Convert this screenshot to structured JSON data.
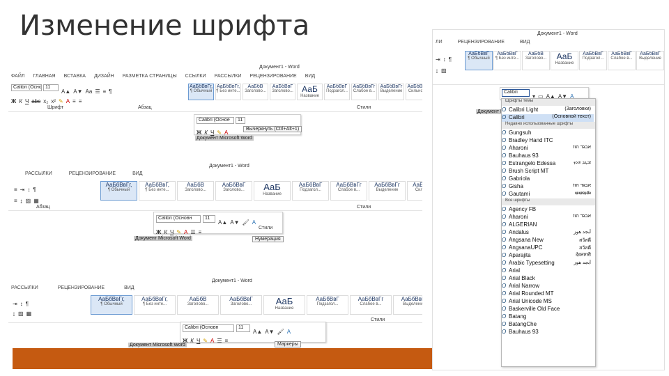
{
  "title": "Изменение шрифта",
  "accent_color": "#c55a11",
  "shot1": {
    "window_title": "Документ1 - Word",
    "tabs": [
      "ФАЙЛ",
      "ГЛАВНАЯ",
      "ВСТАВКА",
      "ДИЗАЙН",
      "РАЗМЕТКА СТРАНИЦЫ",
      "ССЫЛКИ",
      "РАССЫЛКИ",
      "РЕЦЕНЗИРОВАНИЕ",
      "ВИД"
    ],
    "font_name": "Calibri (Осно",
    "font_size": "11",
    "styles": [
      {
        "sample": "АаБбВвГг,",
        "name": "¶ Обычный"
      },
      {
        "sample": "АаБбВвГг,",
        "name": "¶ Без инте..."
      },
      {
        "sample": "АаБбВ",
        "name": "Заголово..."
      },
      {
        "sample": "АаБбВвГ",
        "name": "Заголово..."
      },
      {
        "sample": "АаБ",
        "name": "Название"
      },
      {
        "sample": "АаБбВвГ",
        "name": "Подзагол..."
      },
      {
        "sample": "АаБбВвГг",
        "name": "Слабое в..."
      },
      {
        "sample": "АаБбВвГг",
        "name": "Выделение"
      },
      {
        "sample": "АаБбВвГг",
        "name": "Сильное..."
      }
    ],
    "group_labels": [
      "Шрифт",
      "Абзац",
      "Стили"
    ],
    "mini_font": "Calibri (Осное",
    "mini_size": "11",
    "tooltip": "Вычеркнуть (Ctrl+Alt+1)",
    "doc_text": "Документ Microsoft Word"
  },
  "shot2": {
    "window_title": "Документ1 - Word",
    "tabs": [
      "РАССЫЛКИ",
      "РЕЦЕНЗИРОВАНИЕ",
      "ВИД"
    ],
    "styles": [
      {
        "sample": "АаБбВвГг,",
        "name": "¶ Обычный"
      },
      {
        "sample": "АаБбВвГ,",
        "name": "¶ Без инте..."
      },
      {
        "sample": "АаБбВ",
        "name": "Заголово..."
      },
      {
        "sample": "АаБбВвГ",
        "name": "Заголово..."
      },
      {
        "sample": "АаБ",
        "name": "Название"
      },
      {
        "sample": "АаБбВвГ",
        "name": "Подзагол..."
      },
      {
        "sample": "АаБбВвГг",
        "name": "Слабое в..."
      },
      {
        "sample": "АаБбВвГг",
        "name": "Выделение"
      },
      {
        "sample": "АаБбВвГг",
        "name": "Сильное..."
      }
    ],
    "group_labels": [
      "Абзац",
      "Стили"
    ],
    "mini_font": "Calibri (Основн",
    "mini_size": "11",
    "mini_styles_label": "Стили",
    "tooltip": "Нумерация",
    "doc_text": "Документ Microsoft Word"
  },
  "shot3": {
    "window_title": "Документ1 - Word",
    "tabs": [
      "РАССЫЛКИ",
      "РЕЦЕНЗИРОВАНИЕ",
      "ВИД"
    ],
    "styles": [
      {
        "sample": "АаБбВвГг,",
        "name": "¶ Обычный"
      },
      {
        "sample": "АаБбВвГг,",
        "name": "¶ Без инте..."
      },
      {
        "sample": "АаБбВ",
        "name": "Заголово..."
      },
      {
        "sample": "АаБбВвГ",
        "name": "Заголово..."
      },
      {
        "sample": "АаБ",
        "name": "Название"
      },
      {
        "sample": "АаБбВвГ",
        "name": "Подзагол..."
      },
      {
        "sample": "АаБбВвГг",
        "name": "Слабое в..."
      },
      {
        "sample": "АаБбВвГг",
        "name": "Выделение"
      }
    ],
    "group_labels": [
      "Стили"
    ],
    "mini_font": "Calibri (Основн",
    "mini_size": "11",
    "tooltip": "Маркеры",
    "doc_text": "Документ Microsoft Word"
  },
  "shot4": {
    "window_title": "Документ1 - Word",
    "tabs": [
      "ЛИ",
      "РЕЦЕНЗИРОВАНИЕ",
      "ВИД"
    ],
    "styles": [
      {
        "sample": "АаБбВвГ",
        "name": "¶ Обычный"
      },
      {
        "sample": "АаБбВвГ",
        "name": "¶ Без инте..."
      },
      {
        "sample": "АаБбВ",
        "name": "Заголово..."
      },
      {
        "sample": "АаБ",
        "name": "Название"
      },
      {
        "sample": "АаБбВвГ",
        "name": "Подзагол..."
      },
      {
        "sample": "АаБбВвГ",
        "name": "Слабое в..."
      },
      {
        "sample": "АаБбВвГ",
        "name": "Выделение"
      }
    ],
    "font_input": "Calibri",
    "doc_text": "Документ Micro",
    "headers": {
      "theme": "Шрифты темы",
      "recent": "Недавно использованные шрифты",
      "all": "Все шрифты"
    },
    "theme_fonts": [
      {
        "name": "Calibri Light",
        "preview": "(Заголовки)"
      },
      {
        "name": "Calibri",
        "preview": "(Основной текст)"
      }
    ],
    "recent_fonts": [
      {
        "name": "Gungsuh",
        "preview": ""
      },
      {
        "name": "Bradley Hand ITC",
        "preview": ""
      },
      {
        "name": "Aharoni",
        "preview": "אבגד הוז"
      },
      {
        "name": "Bauhaus 93",
        "preview": ""
      },
      {
        "name": "Estrangelo Edessa",
        "preview": "ܐܒܓܕ ܗܘܙ"
      },
      {
        "name": "Brush Script MT",
        "preview": ""
      },
      {
        "name": "Gabriola",
        "preview": ""
      },
      {
        "name": "Gisha",
        "preview": "אבגד הוז"
      },
      {
        "name": "Gautami",
        "preview": "అఆఇఈ"
      }
    ],
    "all_fonts": [
      {
        "name": "Agency FB",
        "preview": ""
      },
      {
        "name": "Aharoni",
        "preview": "אבגד הוז"
      },
      {
        "name": "ALGERIAN",
        "preview": ""
      },
      {
        "name": "Andalus",
        "preview": "أبجد هوز"
      },
      {
        "name": "Angsana New",
        "preview": "สวัสดี"
      },
      {
        "name": "AngsanaUPC",
        "preview": "สวัสดี"
      },
      {
        "name": "Aparajita",
        "preview": "देवनागरी"
      },
      {
        "name": "Arabic Typesetting",
        "preview": "أبجد هوز"
      },
      {
        "name": "Arial",
        "preview": ""
      },
      {
        "name": "Arial Black",
        "preview": ""
      },
      {
        "name": "Arial Narrow",
        "preview": ""
      },
      {
        "name": "Arial Rounded MT",
        "preview": ""
      },
      {
        "name": "Arial Unicode MS",
        "preview": ""
      },
      {
        "name": "Baskerville Old Face",
        "preview": ""
      },
      {
        "name": "Batang",
        "preview": ""
      },
      {
        "name": "BatangChe",
        "preview": ""
      },
      {
        "name": "Bauhaus 93",
        "preview": ""
      }
    ]
  }
}
